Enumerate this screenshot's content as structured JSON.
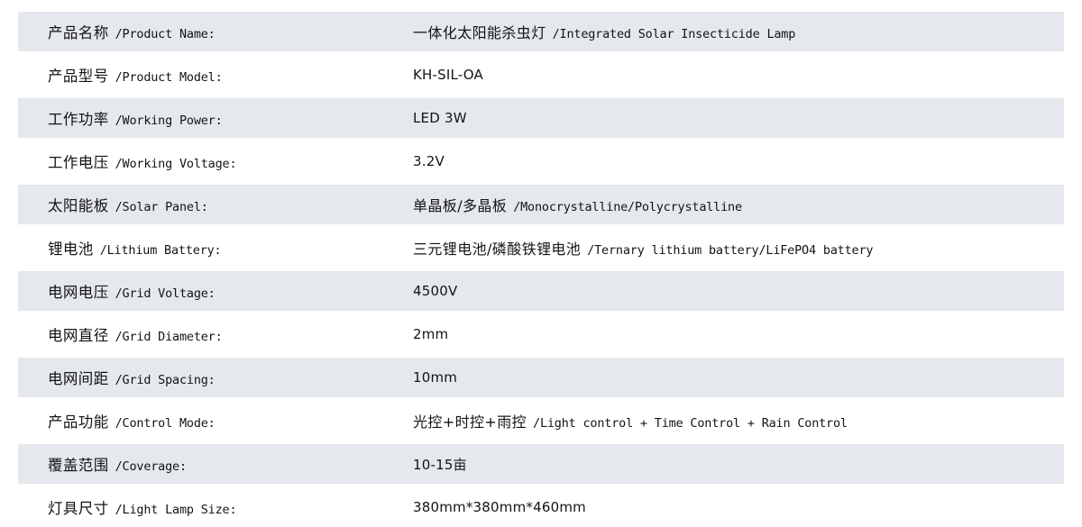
{
  "table": {
    "accent_stripe_color": "#e5e8ec",
    "page_background": "#ffffff",
    "text_color": "#141414",
    "rows": [
      {
        "striped": true,
        "label_cn": "产品名称",
        "label_en": "/Product Name:",
        "value_cn": "一体化太阳能杀虫灯",
        "value_en": "/Integrated Solar Insecticide Lamp"
      },
      {
        "striped": false,
        "label_cn": "产品型号",
        "label_en": "/Product Model:",
        "value_cn": "KH-SIL-OA",
        "value_en": ""
      },
      {
        "striped": true,
        "label_cn": "工作功率",
        "label_en": "/Working Power:",
        "value_cn": "LED 3W",
        "value_en": ""
      },
      {
        "striped": false,
        "label_cn": "工作电压",
        "label_en": "/Working Voltage:",
        "value_cn": "3.2V",
        "value_en": ""
      },
      {
        "striped": true,
        "label_cn": "太阳能板",
        "label_en": "/Solar Panel:",
        "value_cn": "单晶板/多晶板",
        "value_en": "/Monocrystalline/Polycrystalline"
      },
      {
        "striped": false,
        "label_cn": "锂电池",
        "label_en": "/Lithium Battery:",
        "value_cn": "三元锂电池/磷酸铁锂电池",
        "value_en": "/Ternary lithium battery/LiFePO4 battery"
      },
      {
        "striped": true,
        "label_cn": "电网电压",
        "label_en": "/Grid Voltage:",
        "value_cn": "4500V",
        "value_en": ""
      },
      {
        "striped": false,
        "label_cn": "电网直径",
        "label_en": "/Grid Diameter:",
        "value_cn": "2mm",
        "value_en": ""
      },
      {
        "striped": true,
        "label_cn": "电网间距",
        "label_en": "/Grid Spacing:",
        "value_cn": "10mm",
        "value_en": ""
      },
      {
        "striped": false,
        "label_cn": "产品功能",
        "label_en": "/Control Mode:",
        "value_cn": "光控+时控+雨控",
        "value_en": "/Light control + Time Control + Rain Control"
      },
      {
        "striped": true,
        "label_cn": "覆盖范围",
        "label_en": "/Coverage:",
        "value_cn": "10-15亩",
        "value_en": ""
      },
      {
        "striped": false,
        "label_cn": "灯具尺寸",
        "label_en": "/Light Lamp Size:",
        "value_cn": "380mm*380mm*460mm",
        "value_en": ""
      }
    ]
  }
}
